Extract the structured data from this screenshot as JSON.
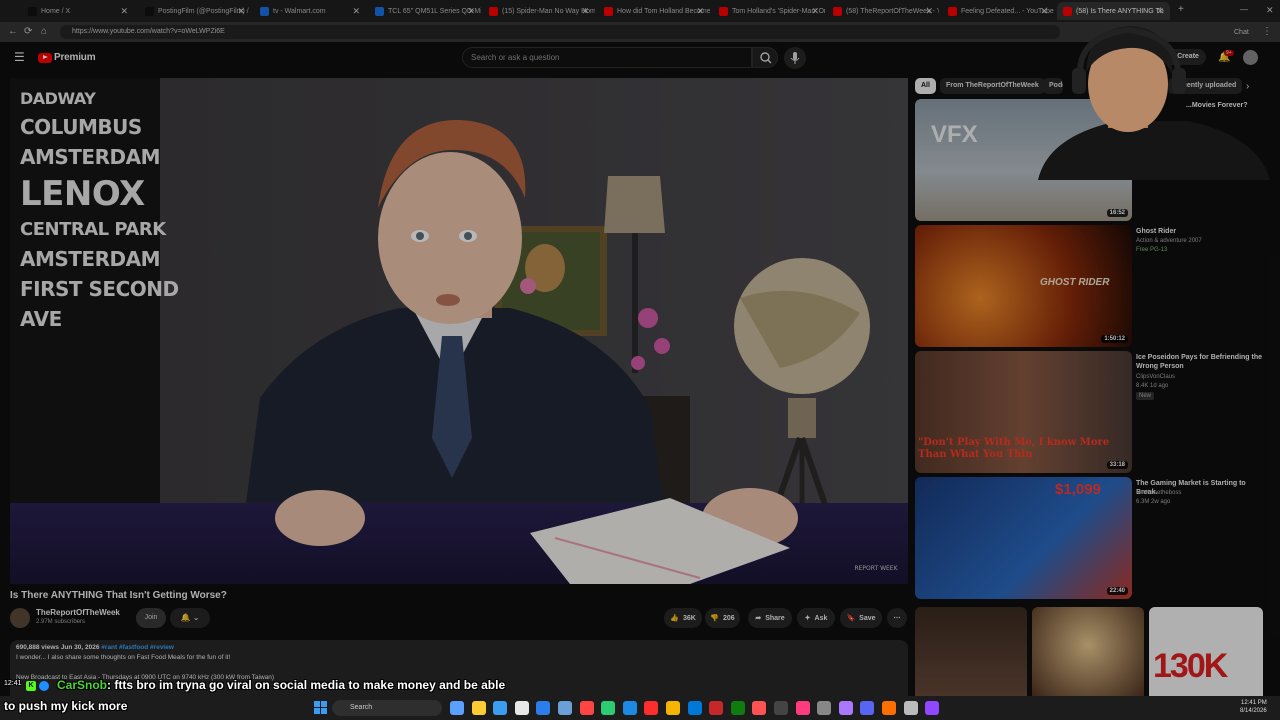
{
  "browser": {
    "tabs": [
      {
        "title": "Home / X",
        "color": "#111111"
      },
      {
        "title": "PostingFilm (@PostingFilm) / X",
        "color": "#111111"
      },
      {
        "title": "tv - Walmart.com",
        "color": "#1a73e8"
      },
      {
        "title": "TCL 65\" QM51L Series QD-Mini",
        "color": "#1a73e8"
      },
      {
        "title": "(15) Spider-Man No Way Home:",
        "color": "#ff0000"
      },
      {
        "title": "How did Tom Holland Become S",
        "color": "#ff0000"
      },
      {
        "title": "Tom Holland's 'Spider-Man' Oru",
        "color": "#ff0000"
      },
      {
        "title": "(58) TheReportOfTheWeek - You",
        "color": "#ff0000"
      },
      {
        "title": "Feeling Defeated... - YouTube",
        "color": "#ff0000"
      },
      {
        "title": "(58) Is There ANYTHING Th",
        "color": "#ff0000"
      }
    ],
    "url": "https://www.youtube.com/watch?v=oWeLWPZi6E",
    "chat_label": "Chat"
  },
  "youtube": {
    "logo_text": "Premium",
    "search_placeholder": "Search or ask a question",
    "create_label": "Create",
    "notification_count": "9+",
    "video": {
      "title": "Is There ANYTHING That Isn't Getting Worse?",
      "channel": "TheReportOfTheWeek",
      "subscribers": "2.97M subscribers",
      "join_label": "Join",
      "likes": "36K",
      "dislikes": "206",
      "share_label": "Share",
      "ask_label": "Ask",
      "save_label": "Save",
      "watermark": "REPORT WEEK",
      "views_date": "690,888 views  Jun 30, 2026",
      "tags": "#rant #fastfood #review",
      "desc_line1": "I wonder... I also share some thoughts on Fast Food Meals for the fun of it!",
      "desc_line2": "New Broadcast to East Asia - Thursdays at 0900 UTC on 9740 kHz (300 kW from Taiwan)",
      "signs": [
        "DADWAY",
        "COLUMBUS",
        "AMSTERDAM",
        "LENOX",
        "CENTRAL PARK",
        "AMSTERDAM",
        "FIRST SECOND",
        "AVE"
      ]
    },
    "chips": [
      "All",
      "From TheReportOfTheWeek",
      "Podcasts",
      "Recently uploaded"
    ],
    "recommendations": [
      {
        "thumb_text": "VFX",
        "duration": "16:52",
        "title": "...Movies Forever?",
        "meta1": "",
        "meta2": ""
      },
      {
        "thumb_text": "GHOST RIDER",
        "duration": "1:50:12",
        "title": "Ghost Rider",
        "meta1": "Action & adventure 2007",
        "meta2": "Free  PG-13"
      },
      {
        "thumb_text": "\"Don't Play With Me, I know More Than What You Thin",
        "duration": "33:18",
        "title": "Ice Poseidon Pays for Befriending the Wrong Person",
        "meta1": "ClipsVonClaus",
        "meta2": "8.4K  1d ago",
        "badge": "New"
      },
      {
        "thumb_text": "$1,099",
        "duration": "22:40",
        "title": "The Gaming Market is Starting to Break.",
        "meta1": "Mrwhosetheboss",
        "meta2": "6.3M  2w ago"
      }
    ],
    "bottom_thumb_text": "130K"
  },
  "chat": {
    "time": "12:41",
    "user": "CarSnob",
    "message_line1": ": ftts bro im tryna go viral on social media to make money and be able",
    "message_line2": "to push my kick more",
    "user_color": "#4cd137"
  },
  "taskbar": {
    "search_label": "Search",
    "time": "12:41 PM",
    "date": "8/14/2026"
  }
}
